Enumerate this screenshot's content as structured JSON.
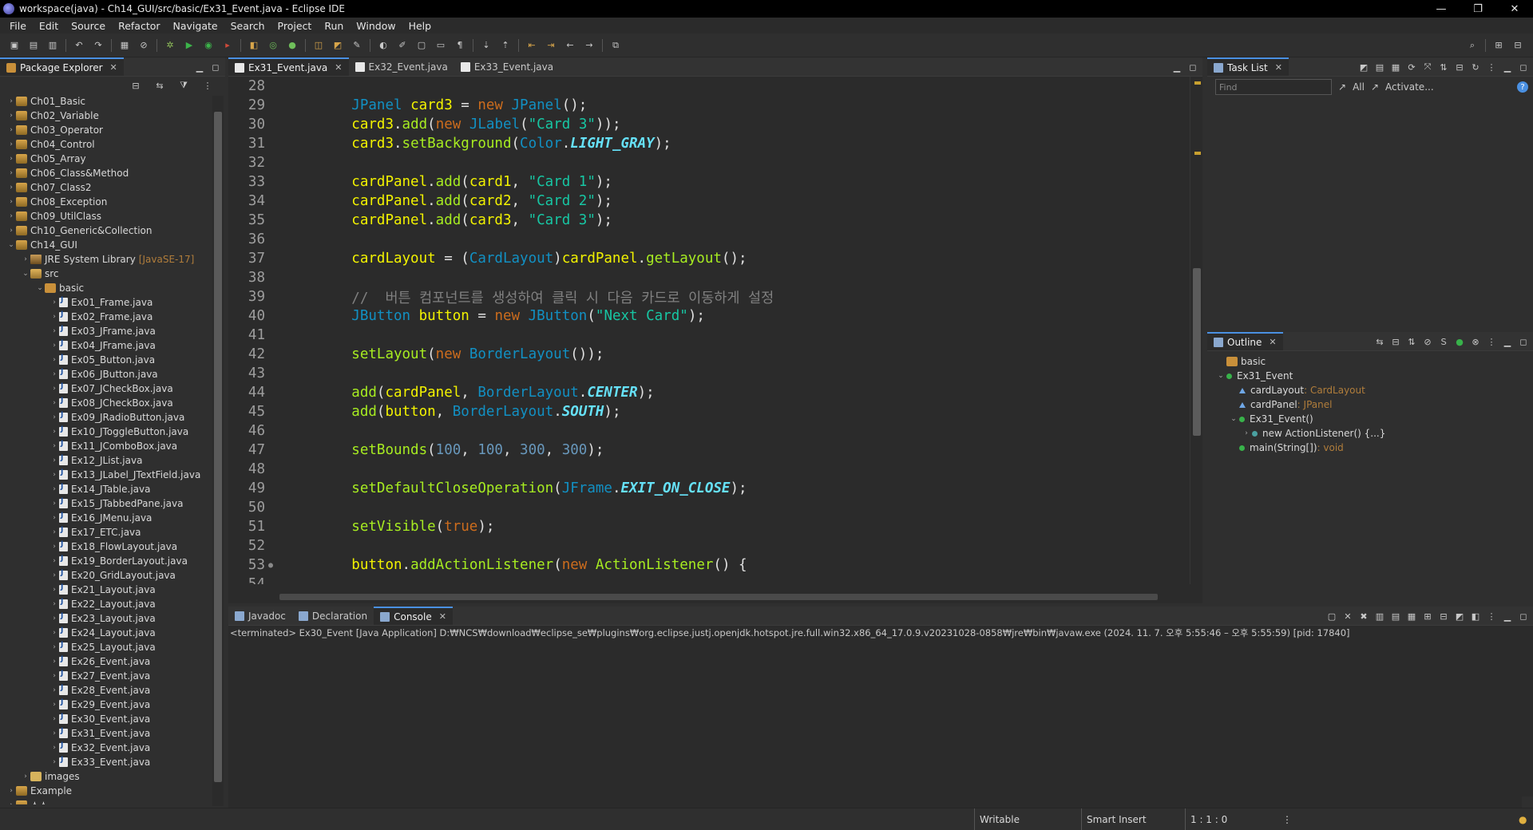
{
  "window": {
    "title": "workspace(java) - Ch14_GUI/src/basic/Ex31_Event.java - Eclipse IDE",
    "minimize": "—",
    "maximize": "❐",
    "close": "✕"
  },
  "menu": [
    "File",
    "Edit",
    "Source",
    "Refactor",
    "Navigate",
    "Search",
    "Project",
    "Run",
    "Window",
    "Help"
  ],
  "package_explorer": {
    "tab_label": "Package Explorer",
    "items": [
      {
        "label": "Ch01_Basic",
        "depth": 0,
        "icon": "proj",
        "arrow": "›"
      },
      {
        "label": "Ch02_Variable",
        "depth": 0,
        "icon": "proj",
        "arrow": "›"
      },
      {
        "label": "Ch03_Operator",
        "depth": 0,
        "icon": "proj",
        "arrow": "›"
      },
      {
        "label": "Ch04_Control",
        "depth": 0,
        "icon": "proj",
        "arrow": "›"
      },
      {
        "label": "Ch05_Array",
        "depth": 0,
        "icon": "proj",
        "arrow": "›"
      },
      {
        "label": "Ch06_Class&Method",
        "depth": 0,
        "icon": "proj",
        "arrow": "›"
      },
      {
        "label": "Ch07_Class2",
        "depth": 0,
        "icon": "proj",
        "arrow": "›"
      },
      {
        "label": "Ch08_Exception",
        "depth": 0,
        "icon": "proj",
        "arrow": "›"
      },
      {
        "label": "Ch09_UtilClass",
        "depth": 0,
        "icon": "proj",
        "arrow": "›"
      },
      {
        "label": "Ch10_Generic&Collection",
        "depth": 0,
        "icon": "proj",
        "arrow": "›"
      },
      {
        "label": "Ch14_GUI",
        "depth": 0,
        "icon": "proj",
        "arrow": "⌄"
      },
      {
        "label": "JRE System Library",
        "tag": "[JavaSE-17]",
        "depth": 1,
        "icon": "lib",
        "arrow": "›"
      },
      {
        "label": "src",
        "depth": 1,
        "icon": "src",
        "arrow": "⌄"
      },
      {
        "label": "basic",
        "depth": 2,
        "icon": "pkgico",
        "arrow": "⌄"
      },
      {
        "label": "Ex01_Frame.java",
        "depth": 3,
        "icon": "java",
        "arrow": "›"
      },
      {
        "label": "Ex02_Frame.java",
        "depth": 3,
        "icon": "java",
        "arrow": "›"
      },
      {
        "label": "Ex03_JFrame.java",
        "depth": 3,
        "icon": "java",
        "arrow": "›"
      },
      {
        "label": "Ex04_JFrame.java",
        "depth": 3,
        "icon": "java",
        "arrow": "›"
      },
      {
        "label": "Ex05_Button.java",
        "depth": 3,
        "icon": "java",
        "arrow": "›"
      },
      {
        "label": "Ex06_JButton.java",
        "depth": 3,
        "icon": "java",
        "arrow": "›"
      },
      {
        "label": "Ex07_JCheckBox.java",
        "depth": 3,
        "icon": "java",
        "arrow": "›"
      },
      {
        "label": "Ex08_JCheckBox.java",
        "depth": 3,
        "icon": "java",
        "arrow": "›"
      },
      {
        "label": "Ex09_JRadioButton.java",
        "depth": 3,
        "icon": "java",
        "arrow": "›"
      },
      {
        "label": "Ex10_JToggleButton.java",
        "depth": 3,
        "icon": "java",
        "arrow": "›"
      },
      {
        "label": "Ex11_JComboBox.java",
        "depth": 3,
        "icon": "java",
        "arrow": "›"
      },
      {
        "label": "Ex12_JList.java",
        "depth": 3,
        "icon": "java",
        "arrow": "›"
      },
      {
        "label": "Ex13_JLabel_JTextField.java",
        "depth": 3,
        "icon": "java",
        "arrow": "›"
      },
      {
        "label": "Ex14_JTable.java",
        "depth": 3,
        "icon": "java",
        "arrow": "›"
      },
      {
        "label": "Ex15_JTabbedPane.java",
        "depth": 3,
        "icon": "java",
        "arrow": "›"
      },
      {
        "label": "Ex16_JMenu.java",
        "depth": 3,
        "icon": "java",
        "arrow": "›"
      },
      {
        "label": "Ex17_ETC.java",
        "depth": 3,
        "icon": "java",
        "arrow": "›"
      },
      {
        "label": "Ex18_FlowLayout.java",
        "depth": 3,
        "icon": "java",
        "arrow": "›"
      },
      {
        "label": "Ex19_BorderLayout.java",
        "depth": 3,
        "icon": "java",
        "arrow": "›"
      },
      {
        "label": "Ex20_GridLayout.java",
        "depth": 3,
        "icon": "java",
        "arrow": "›"
      },
      {
        "label": "Ex21_Layout.java",
        "depth": 3,
        "icon": "java",
        "arrow": "›"
      },
      {
        "label": "Ex22_Layout.java",
        "depth": 3,
        "icon": "java",
        "arrow": "›"
      },
      {
        "label": "Ex23_Layout.java",
        "depth": 3,
        "icon": "java",
        "arrow": "›"
      },
      {
        "label": "Ex24_Layout.java",
        "depth": 3,
        "icon": "java",
        "arrow": "›"
      },
      {
        "label": "Ex25_Layout.java",
        "depth": 3,
        "icon": "java",
        "arrow": "›"
      },
      {
        "label": "Ex26_Event.java",
        "depth": 3,
        "icon": "java",
        "arrow": "›"
      },
      {
        "label": "Ex27_Event.java",
        "depth": 3,
        "icon": "java",
        "arrow": "›"
      },
      {
        "label": "Ex28_Event.java",
        "depth": 3,
        "icon": "java",
        "arrow": "›"
      },
      {
        "label": "Ex29_Event.java",
        "depth": 3,
        "icon": "java",
        "arrow": "›"
      },
      {
        "label": "Ex30_Event.java",
        "depth": 3,
        "icon": "java",
        "arrow": "›"
      },
      {
        "label": "Ex31_Event.java",
        "depth": 3,
        "icon": "java",
        "arrow": "›"
      },
      {
        "label": "Ex32_Event.java",
        "depth": 3,
        "icon": "java",
        "arrow": "›"
      },
      {
        "label": "Ex33_Event.java",
        "depth": 3,
        "icon": "java",
        "arrow": "›"
      },
      {
        "label": "images",
        "depth": 1,
        "icon": "folder",
        "arrow": "›"
      },
      {
        "label": "Example",
        "depth": 0,
        "icon": "proj",
        "arrow": "›"
      },
      {
        "label": "소스",
        "depth": 0,
        "icon": "proj",
        "arrow": "›"
      }
    ]
  },
  "editor": {
    "tabs": [
      {
        "label": "Ex31_Event.java",
        "active": true
      },
      {
        "label": "Ex32_Event.java",
        "active": false
      },
      {
        "label": "Ex33_Event.java",
        "active": false
      }
    ],
    "lines": [
      {
        "n": "28",
        "mark": "",
        "toks": []
      },
      {
        "n": "29",
        "mark": "",
        "toks": [
          [
            "",
            "        "
          ],
          [
            "type",
            "JPanel"
          ],
          [
            "",
            " "
          ],
          [
            "var",
            "card3"
          ],
          [
            "",
            " = "
          ],
          [
            "kw",
            "new"
          ],
          [
            "",
            " "
          ],
          [
            "type",
            "JPanel"
          ],
          [
            "",
            "();"
          ]
        ]
      },
      {
        "n": "30",
        "mark": "",
        "toks": [
          [
            "",
            "        "
          ],
          [
            "var",
            "card3"
          ],
          [
            "",
            "."
          ],
          [
            "method",
            "add"
          ],
          [
            "",
            "("
          ],
          [
            "kw",
            "new"
          ],
          [
            "",
            " "
          ],
          [
            "type",
            "JLabel"
          ],
          [
            "",
            "("
          ],
          [
            "str",
            "\"Card 3\""
          ],
          [
            "",
            "));"
          ]
        ]
      },
      {
        "n": "31",
        "mark": "",
        "toks": [
          [
            "",
            "        "
          ],
          [
            "var",
            "card3"
          ],
          [
            "",
            "."
          ],
          [
            "method",
            "setBackground"
          ],
          [
            "",
            "("
          ],
          [
            "type",
            "Color"
          ],
          [
            "",
            "."
          ],
          [
            "field",
            "LIGHT_GRAY"
          ],
          [
            "",
            ");"
          ]
        ]
      },
      {
        "n": "32",
        "mark": "",
        "toks": []
      },
      {
        "n": "33",
        "mark": "",
        "toks": [
          [
            "",
            "        "
          ],
          [
            "var",
            "cardPanel"
          ],
          [
            "",
            "."
          ],
          [
            "method",
            "add"
          ],
          [
            "",
            "("
          ],
          [
            "var",
            "card1"
          ],
          [
            "",
            ", "
          ],
          [
            "str",
            "\"Card 1\""
          ],
          [
            "",
            ");"
          ]
        ]
      },
      {
        "n": "34",
        "mark": "",
        "toks": [
          [
            "",
            "        "
          ],
          [
            "var",
            "cardPanel"
          ],
          [
            "",
            "."
          ],
          [
            "method",
            "add"
          ],
          [
            "",
            "("
          ],
          [
            "var",
            "card2"
          ],
          [
            "",
            ", "
          ],
          [
            "str",
            "\"Card 2\""
          ],
          [
            "",
            ");"
          ]
        ]
      },
      {
        "n": "35",
        "mark": "",
        "toks": [
          [
            "",
            "        "
          ],
          [
            "var",
            "cardPanel"
          ],
          [
            "",
            "."
          ],
          [
            "method",
            "add"
          ],
          [
            "",
            "("
          ],
          [
            "var",
            "card3"
          ],
          [
            "",
            ", "
          ],
          [
            "str",
            "\"Card 3\""
          ],
          [
            "",
            ");"
          ]
        ]
      },
      {
        "n": "36",
        "mark": "",
        "toks": []
      },
      {
        "n": "37",
        "mark": "",
        "toks": [
          [
            "",
            "        "
          ],
          [
            "var",
            "cardLayout"
          ],
          [
            "",
            " = ("
          ],
          [
            "type",
            "CardLayout"
          ],
          [
            "",
            ")"
          ],
          [
            "var",
            "cardPanel"
          ],
          [
            "",
            "."
          ],
          [
            "method",
            "getLayout"
          ],
          [
            "",
            "();"
          ]
        ]
      },
      {
        "n": "38",
        "mark": "",
        "toks": []
      },
      {
        "n": "39",
        "mark": "",
        "toks": [
          [
            "",
            "        "
          ],
          [
            "comment",
            "//  버튼 컴포넌트를 생성하여 클릭 시 다음 카드로 이동하게 설정"
          ]
        ]
      },
      {
        "n": "40",
        "mark": "",
        "toks": [
          [
            "",
            "        "
          ],
          [
            "type",
            "JButton"
          ],
          [
            "",
            " "
          ],
          [
            "var",
            "button"
          ],
          [
            "",
            " = "
          ],
          [
            "kw",
            "new"
          ],
          [
            "",
            " "
          ],
          [
            "type",
            "JButton"
          ],
          [
            "",
            "("
          ],
          [
            "str",
            "\"Next Card\""
          ],
          [
            "",
            ");"
          ]
        ]
      },
      {
        "n": "41",
        "mark": "",
        "toks": []
      },
      {
        "n": "42",
        "mark": "",
        "toks": [
          [
            "",
            "        "
          ],
          [
            "method",
            "setLayout"
          ],
          [
            "",
            "("
          ],
          [
            "kw",
            "new"
          ],
          [
            "",
            " "
          ],
          [
            "type",
            "BorderLayout"
          ],
          [
            "",
            "());"
          ]
        ]
      },
      {
        "n": "43",
        "mark": "",
        "toks": []
      },
      {
        "n": "44",
        "mark": "",
        "toks": [
          [
            "",
            "        "
          ],
          [
            "method",
            "add"
          ],
          [
            "",
            "("
          ],
          [
            "var",
            "cardPanel"
          ],
          [
            "",
            ", "
          ],
          [
            "type",
            "BorderLayout"
          ],
          [
            "",
            "."
          ],
          [
            "field",
            "CENTER"
          ],
          [
            "",
            ");"
          ]
        ]
      },
      {
        "n": "45",
        "mark": "",
        "toks": [
          [
            "",
            "        "
          ],
          [
            "method",
            "add"
          ],
          [
            "",
            "("
          ],
          [
            "var",
            "button"
          ],
          [
            "",
            ", "
          ],
          [
            "type",
            "BorderLayout"
          ],
          [
            "",
            "."
          ],
          [
            "field",
            "SOUTH"
          ],
          [
            "",
            ");"
          ]
        ]
      },
      {
        "n": "46",
        "mark": "",
        "toks": []
      },
      {
        "n": "47",
        "mark": "",
        "toks": [
          [
            "",
            "        "
          ],
          [
            "method",
            "setBounds"
          ],
          [
            "",
            "("
          ],
          [
            "num",
            "100"
          ],
          [
            "",
            ", "
          ],
          [
            "num",
            "100"
          ],
          [
            "",
            ", "
          ],
          [
            "num",
            "300"
          ],
          [
            "",
            ", "
          ],
          [
            "num",
            "300"
          ],
          [
            "",
            ");"
          ]
        ]
      },
      {
        "n": "48",
        "mark": "",
        "toks": []
      },
      {
        "n": "49",
        "mark": "",
        "toks": [
          [
            "",
            "        "
          ],
          [
            "method",
            "setDefaultCloseOperation"
          ],
          [
            "",
            "("
          ],
          [
            "type",
            "JFrame"
          ],
          [
            "",
            "."
          ],
          [
            "field",
            "EXIT_ON_CLOSE"
          ],
          [
            "",
            ");"
          ]
        ]
      },
      {
        "n": "50",
        "mark": "",
        "toks": []
      },
      {
        "n": "51",
        "mark": "",
        "toks": [
          [
            "",
            "        "
          ],
          [
            "method",
            "setVisible"
          ],
          [
            "",
            "("
          ],
          [
            "kw",
            "true"
          ],
          [
            "",
            ");"
          ]
        ]
      },
      {
        "n": "52",
        "mark": "",
        "toks": []
      },
      {
        "n": "53",
        "mark": "●",
        "toks": [
          [
            "",
            "        "
          ],
          [
            "var",
            "button"
          ],
          [
            "",
            "."
          ],
          [
            "method",
            "addActionListener"
          ],
          [
            "",
            "("
          ],
          [
            "kw",
            "new"
          ],
          [
            "",
            " "
          ],
          [
            "method",
            "ActionListener"
          ],
          [
            "",
            "() {"
          ]
        ]
      },
      {
        "n": "54",
        "mark": "",
        "toks": []
      }
    ]
  },
  "task_list": {
    "tab_label": "Task List",
    "find_placeholder": "Find",
    "all_label": "All",
    "activate_label": "Activate..."
  },
  "outline": {
    "tab_label": "Outline",
    "items": [
      {
        "label": "basic",
        "type": "",
        "depth": 0,
        "arrow": "",
        "icon": "pkg"
      },
      {
        "label": "Ex31_Event",
        "type": "",
        "depth": 0,
        "arrow": "⌄",
        "icon": "class"
      },
      {
        "label": "cardLayout",
        "type": " : CardLayout",
        "depth": 1,
        "arrow": "",
        "icon": "field"
      },
      {
        "label": "cardPanel",
        "type": " : JPanel",
        "depth": 1,
        "arrow": "",
        "icon": "field"
      },
      {
        "label": "Ex31_Event()",
        "type": "",
        "depth": 1,
        "arrow": "⌄",
        "icon": "method"
      },
      {
        "label": "new ActionListener() {...}",
        "type": "",
        "depth": 2,
        "arrow": "›",
        "icon": "anon"
      },
      {
        "label": "main(String[])",
        "type": " : void",
        "depth": 1,
        "arrow": "",
        "icon": "method"
      }
    ]
  },
  "console": {
    "tabs": [
      {
        "label": "Javadoc",
        "active": false
      },
      {
        "label": "Declaration",
        "active": false
      },
      {
        "label": "Console",
        "active": true
      }
    ],
    "terminated_line": "<terminated> Ex30_Event [Java Application] D:₩NCS₩download₩eclipse_se₩plugins₩org.eclipse.justj.openjdk.hotspot.jre.full.win32.x86_64_17.0.9.v20231028-0858₩jre₩bin₩javaw.exe  (2024. 11. 7. 오후 5:55:46 – 오후 5:55:59) [pid: 17840]"
  },
  "status": {
    "writable": "Writable",
    "insert_mode": "Smart Insert",
    "position": "1 : 1 : 0"
  },
  "colors": {
    "background": "#2f2f2f",
    "editor_bg": "#2b2b2b",
    "accent": "#4a90e2",
    "keyword": "#cc6c1d",
    "type": "#1290c3",
    "string": "#17c6a3"
  }
}
